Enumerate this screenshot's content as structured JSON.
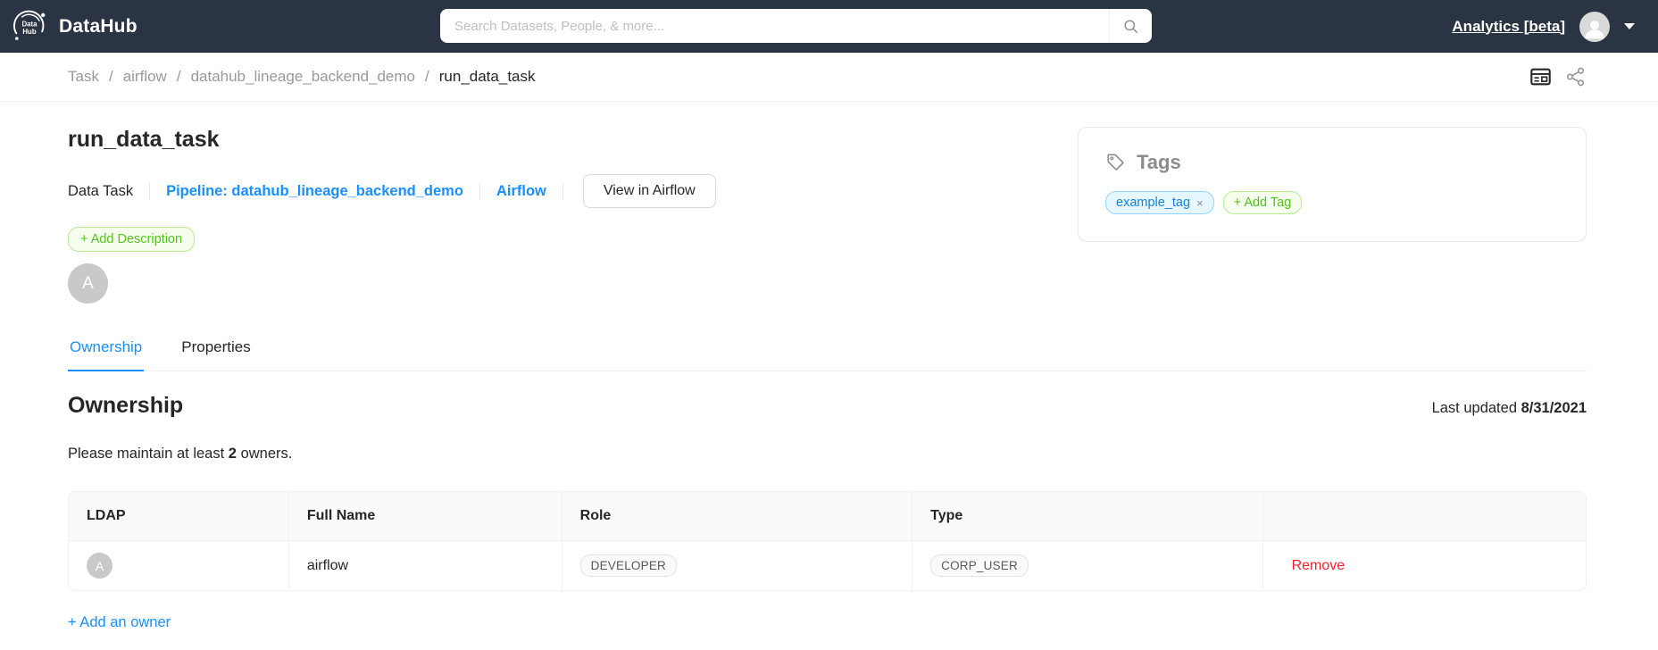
{
  "nav": {
    "brand": "DataHub",
    "search_placeholder": "Search Datasets, People, & more...",
    "analytics_label": "Analytics [beta]"
  },
  "breadcrumb": {
    "separator": "/",
    "items": [
      "Task",
      "airflow",
      "datahub_lineage_backend_demo",
      "run_data_task"
    ]
  },
  "entity": {
    "title": "run_data_task",
    "type_label": "Data Task",
    "pipeline_link": "Pipeline: datahub_lineage_backend_demo",
    "platform_link": "Airflow",
    "external_button": "View in Airflow",
    "add_description_label": "+ Add Description",
    "owner_avatar_initial": "A"
  },
  "tags_card": {
    "title": "Tags",
    "tags": [
      {
        "label": "example_tag",
        "remove_glyph": "×"
      }
    ],
    "add_tag_label": "+ Add Tag"
  },
  "tabs": [
    {
      "label": "Ownership",
      "active": true
    },
    {
      "label": "Properties",
      "active": false
    }
  ],
  "ownership": {
    "heading": "Ownership",
    "last_updated_label": "Last updated",
    "last_updated_date": "8/31/2021",
    "note_prefix": "Please maintain at least",
    "note_count": "2",
    "note_suffix": "owners.",
    "table": {
      "headers": [
        "LDAP",
        "Full Name",
        "Role",
        "Type",
        ""
      ],
      "rows": [
        {
          "ldap_initial": "A",
          "full_name": "airflow",
          "role": "DEVELOPER",
          "type": "CORP_USER",
          "action": "Remove"
        }
      ]
    },
    "add_owner_label": "+ Add an owner"
  },
  "icons": {
    "logo": "datahub-orbit-logo",
    "search": "magnifier",
    "user": "person-silhouette",
    "caret_down": "triangle-down",
    "detail_view": "panel-layout",
    "lineage": "share-nodes",
    "tag": "price-tag",
    "tag_close": "×"
  },
  "colors": {
    "navbar_bg": "#2b3443",
    "accent_blue": "#1890ff",
    "green": "#52c41a",
    "green_bg": "#f6ffed",
    "green_border": "#b7eb8f",
    "blue_tag_bg": "#e6f7ff",
    "blue_tag_border": "#91d5ff",
    "red": "#f5222d",
    "border_light": "#f0f0f0",
    "header_bg": "#fafafa",
    "avatar_gray": "#c9c9c9"
  }
}
